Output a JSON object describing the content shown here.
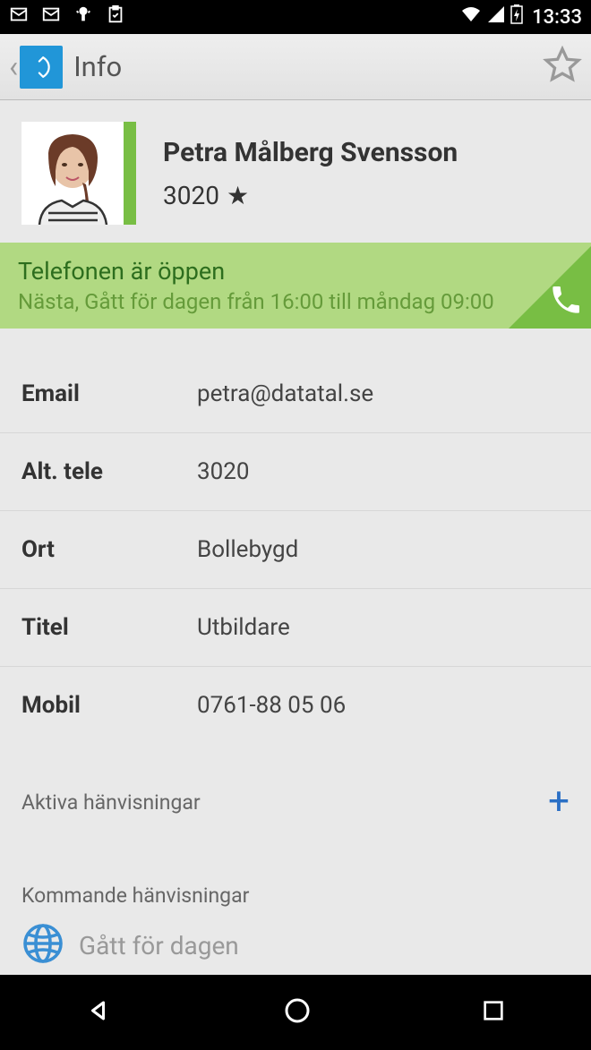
{
  "statusBar": {
    "time": "13:33"
  },
  "actionBar": {
    "title": "Info"
  },
  "profile": {
    "name": "Petra Målberg Svensson",
    "number": "3020"
  },
  "statusBanner": {
    "title": "Telefonen är öppen",
    "subtitle": "Nästa, Gått för dagen från 16:00 till måndag 09:00"
  },
  "details": [
    {
      "label": "Email",
      "value": "petra@datatal.se"
    },
    {
      "label": "Alt. tele",
      "value": "3020"
    },
    {
      "label": "Ort",
      "value": "Bollebygd"
    },
    {
      "label": "Titel",
      "value": "Utbildare"
    },
    {
      "label": "Mobil",
      "value": "0761-88 05 06"
    }
  ],
  "sections": {
    "active": "Aktiva hänvisningar",
    "upcoming": "Kommande hänvisningar",
    "upcomingItem": "Gått för dagen"
  }
}
